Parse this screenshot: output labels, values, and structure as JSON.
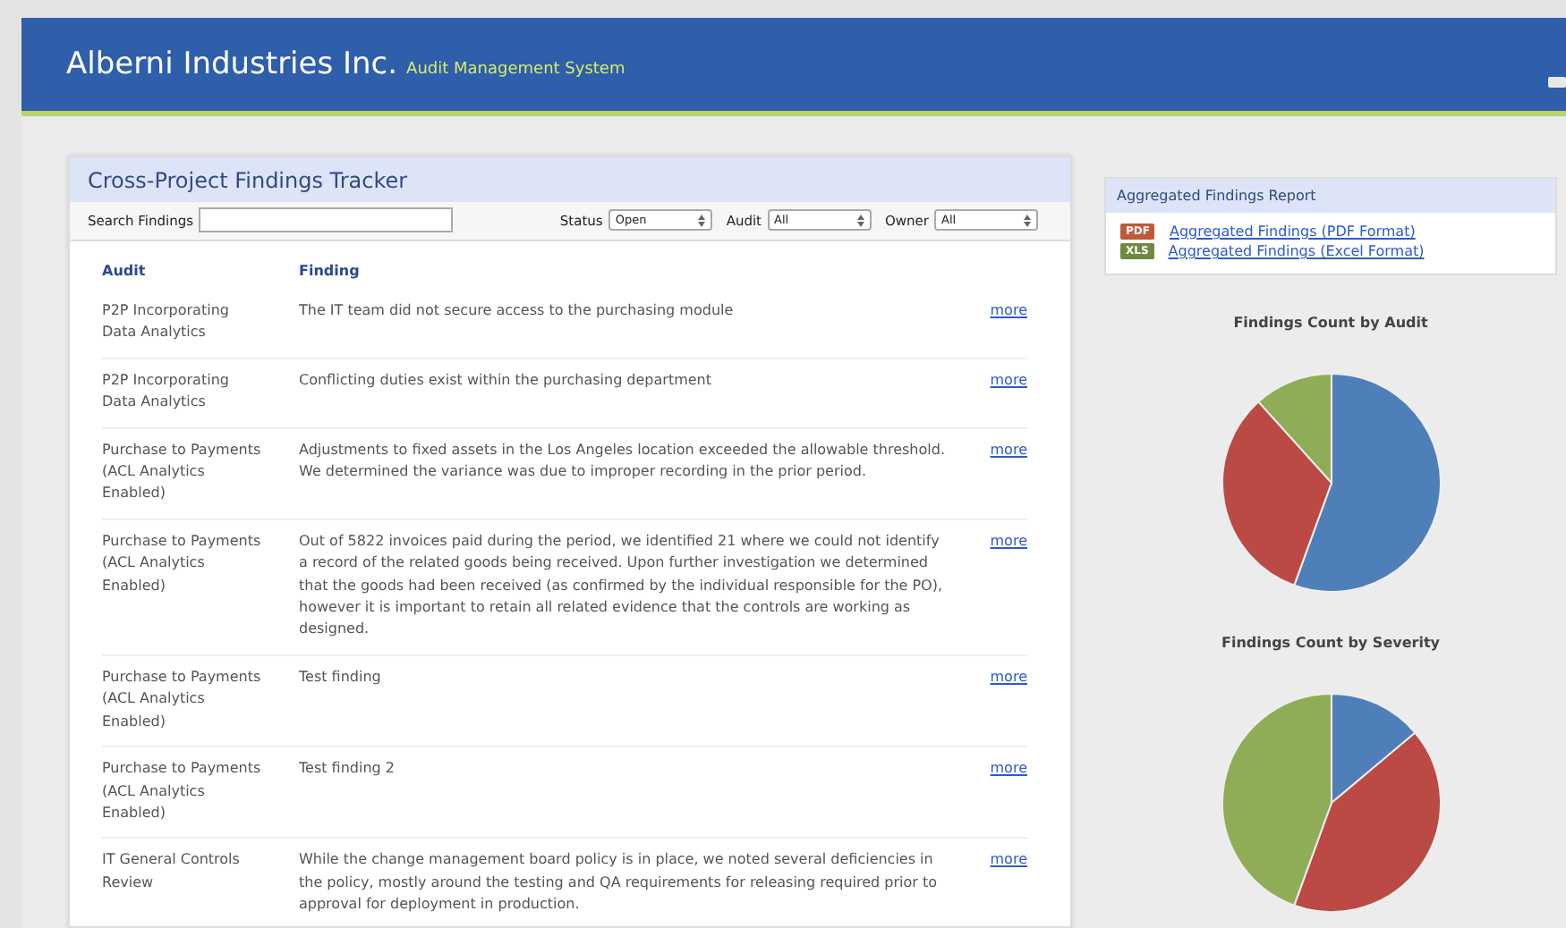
{
  "header": {
    "company": "Alberni Industries Inc.",
    "subtitle": "Audit Management System"
  },
  "tracker": {
    "title": "Cross-Project Findings Tracker",
    "search": {
      "label": "Search Findings"
    },
    "filters": [
      {
        "label": "Status",
        "value": "Open"
      },
      {
        "label": "Audit",
        "value": "All"
      },
      {
        "label": "Owner",
        "value": "All"
      }
    ],
    "columns": [
      "Audit",
      "Finding"
    ],
    "rows": [
      {
        "audit": "P2P Incorporating Data Analytics",
        "finding": "The IT team did not secure access to the purchasing module",
        "link": "more"
      },
      {
        "audit": "P2P Incorporating Data Analytics",
        "finding": "Conflicting duties exist within the purchasing department",
        "link": "more"
      },
      {
        "audit": "Purchase to Payments (ACL Analytics Enabled)",
        "finding": "Adjustments to fixed assets in the Los Angeles location exceeded the allowable threshold. We determined the variance was due to improper recording in the prior period.",
        "link": "more"
      },
      {
        "audit": "Purchase to Payments (ACL Analytics Enabled)",
        "finding": "Out of 5822 invoices paid during the period, we identified 21 where we could not identify a record of the related goods being received. Upon further investigation we determined that the goods had been received (as confirmed by the individual responsible for the PO), however it is important to retain all related evidence that the controls are working as designed.",
        "link": "more"
      },
      {
        "audit": "Purchase to Payments (ACL Analytics Enabled)",
        "finding": "Test finding",
        "link": "more"
      },
      {
        "audit": "Purchase to Payments (ACL Analytics Enabled)",
        "finding": "Test finding 2",
        "link": "more"
      },
      {
        "audit": "IT General Controls Review",
        "finding": "While the change management board policy is in place, we noted several deficiencies in the policy, mostly around the testing and QA requirements for releasing required prior to approval for deployment in production.",
        "link": "more"
      }
    ]
  },
  "report": {
    "title": "Aggregated Findings Report",
    "links": [
      {
        "badge": "PDF",
        "color": "#c0583a",
        "label": "Aggregated Findings (PDF Format)"
      },
      {
        "badge": "XLS",
        "color": "#6f8a3c",
        "label": "Aggregated Findings (Excel Format)"
      }
    ]
  },
  "charts": [
    {
      "title": "Findings Count by Audit",
      "kind": "audit"
    },
    {
      "title": "Findings Count by Severity",
      "kind": "severity"
    }
  ]
}
